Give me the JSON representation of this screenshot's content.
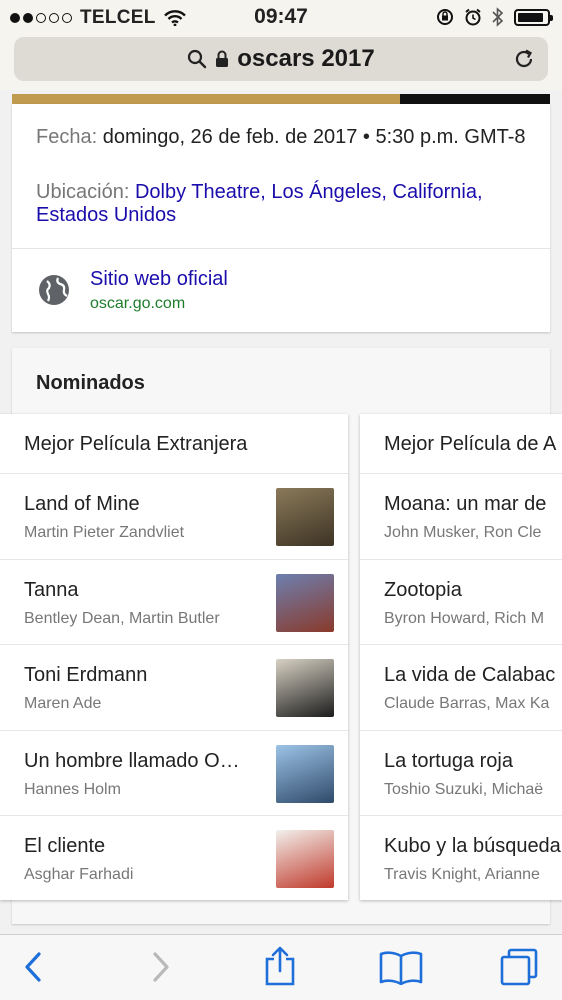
{
  "status_bar": {
    "carrier": "TELCEL",
    "time": "09:47",
    "battery_level": 0.9
  },
  "address_bar": {
    "query": "oscars 2017",
    "icons": [
      "search-icon",
      "lock-icon",
      "reload-icon"
    ]
  },
  "event_info": {
    "date_label": "Fecha:",
    "date_value": "domingo, 26 de feb. de 2017 • 5:30 p.m. GMT-8",
    "location_label": "Ubicación:",
    "location_value": "Dolby Theatre, Los Ángeles, California, Estados Unidos",
    "website_title": "Sitio web oficial",
    "website_url": "oscar.go.com",
    "band_colors": [
      "#c09a4e",
      "#111111"
    ]
  },
  "nominees": {
    "title": "Nominados",
    "categories": [
      {
        "name": "Mejor Película Extranjera",
        "items": [
          {
            "title": "Land of Mine",
            "people": "Martin Pieter Zandvliet",
            "poster_colors": [
              "#8a7a5a",
              "#3d3324"
            ]
          },
          {
            "title": "Tanna",
            "people": "Bentley Dean, Martin Butler",
            "poster_colors": [
              "#6d7fb0",
              "#8a3a2a"
            ]
          },
          {
            "title": "Toni Erdmann",
            "people": "Maren Ade",
            "poster_colors": [
              "#d8d2c4",
              "#1c1c1c"
            ]
          },
          {
            "title": "Un hombre llamado O…",
            "people": "Hannes Holm",
            "poster_colors": [
              "#9cc3e6",
              "#2f4a6a"
            ]
          },
          {
            "title": "El cliente",
            "people": "Asghar Farhadi",
            "poster_colors": [
              "#f2f0ec",
              "#c0392b"
            ]
          }
        ]
      },
      {
        "name": "Mejor Película de A",
        "items": [
          {
            "title": "Moana: un mar de",
            "people": "John Musker, Ron Cle"
          },
          {
            "title": "Zootopia",
            "people": "Byron Howard, Rich M"
          },
          {
            "title": "La vida de Calabac",
            "people": "Claude Barras, Max Ka"
          },
          {
            "title": "La tortuga roja",
            "people": "Toshio Suzuki, Michaë"
          },
          {
            "title": "Kubo y la búsqueda",
            "people": "Travis Knight, Arianne"
          }
        ]
      }
    ]
  },
  "toolbar": {
    "buttons": [
      "back-icon",
      "forward-icon",
      "share-icon",
      "bookmarks-icon",
      "tabs-icon"
    ]
  }
}
